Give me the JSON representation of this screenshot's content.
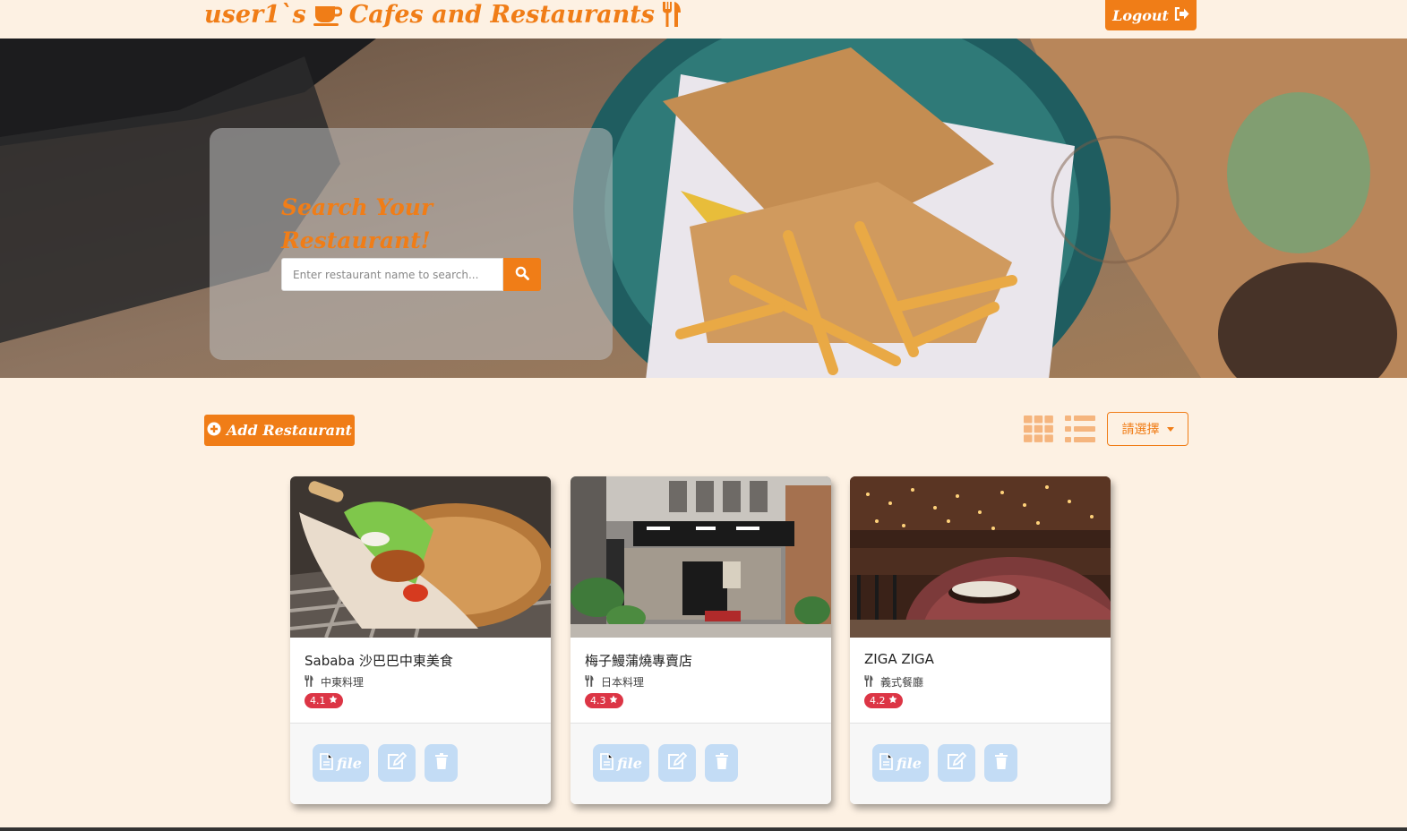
{
  "nav": {
    "brand_user": "user1`s",
    "brand_text": "Cafes and Restaurants",
    "logout_label": "Logout"
  },
  "hero": {
    "title": "Search Your Restaurant!",
    "search_placeholder": "Enter restaurant name to search..."
  },
  "toolbar": {
    "add_label": "Add Restaurant",
    "select_label": "請選擇"
  },
  "restaurants": [
    {
      "name": "Sababa 沙巴巴中東美食",
      "category": "中東料理",
      "rating": "4.1",
      "file_label": "file"
    },
    {
      "name": "梅子鰻蒲燒專賣店",
      "category": "日本料理",
      "rating": "4.3",
      "file_label": "file"
    },
    {
      "name": "ZIGA ZIGA",
      "category": "義式餐廳",
      "rating": "4.2",
      "file_label": "file"
    }
  ],
  "colors": {
    "accent": "#f07d17",
    "background": "#fdf1e3",
    "rating_badge": "#dc3545",
    "action_button": "#c3dcf5"
  },
  "icons": [
    "coffee-icon",
    "utensils-icon",
    "logout-icon",
    "search-icon",
    "plus-circle-icon",
    "grid-view-icon",
    "list-view-icon",
    "file-icon",
    "edit-icon",
    "trash-icon",
    "star-icon"
  ]
}
